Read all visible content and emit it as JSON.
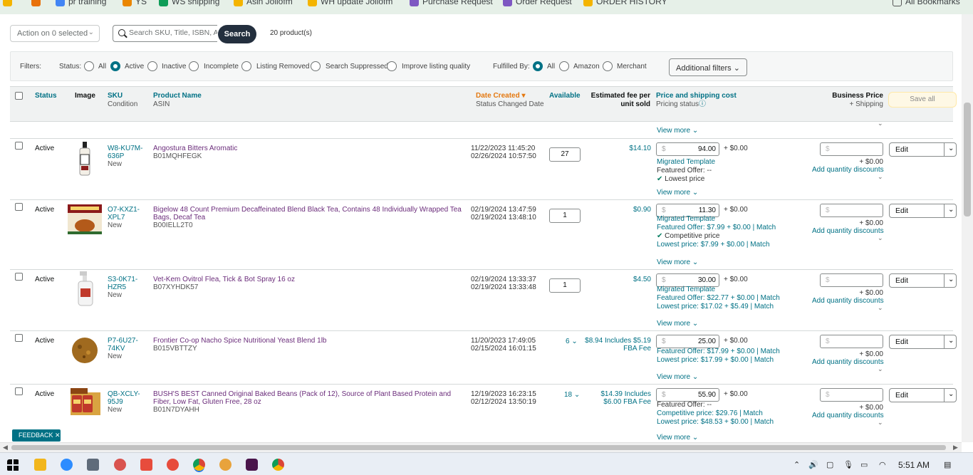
{
  "bookmarks": [
    "pr training",
    "YS",
    "WS shipping",
    "Asin Jollofm",
    "WH update Jollofm",
    "Purchase Request",
    "Order Request",
    "ORDER HISTORY",
    "All Bookmarks"
  ],
  "toolbar": {
    "action_label": "Action on 0 selected",
    "search_placeholder": "Search SKU, Title, ISBN, A",
    "search_button": "Search",
    "product_count": "20 product(s)"
  },
  "filters": {
    "label": "Filters:",
    "status_label": "Status:",
    "status_options": [
      "All",
      "Active",
      "Inactive",
      "Incomplete",
      "Listing Removed",
      "Search Suppressed",
      "Improve listing quality"
    ],
    "status_selected": "Active",
    "fulfilled_label": "Fulfilled By:",
    "fulfilled_options": [
      "All",
      "Amazon",
      "Merchant"
    ],
    "fulfilled_selected": "All",
    "additional_filters": "Additional filters"
  },
  "table_header": {
    "status": "Status",
    "image": "Image",
    "sku": "SKU",
    "condition": "Condition",
    "product_name": "Product Name",
    "asin": "ASIN",
    "date_created": "Date Created",
    "status_changed": "Status Changed Date",
    "available": "Available",
    "fee_line1": "Estimated fee per",
    "fee_line2": "unit sold",
    "price": "Price and shipping cost",
    "pricing_status": "Pricing status",
    "business_price": "Business Price",
    "plus_shipping": "+ Shipping",
    "save_all": "Save all"
  },
  "common": {
    "view_more": "View more",
    "edit": "Edit",
    "shipping": "+ $0.00",
    "bp_shipping": "+ $0.00",
    "add_qty_discounts": "Add quantity discounts",
    "dollar": "$"
  },
  "rows": [
    {
      "status": "Active",
      "sku1": "W8-KU7M-",
      "sku2": "636P",
      "condition": "New",
      "name": "Angostura Bitters Aromatic",
      "asin": "B01MQHFEGK",
      "date_created": "11/22/2023 11:45:20",
      "date_changed": "02/26/2024 10:57:50",
      "available": "27",
      "fee1": "$14.10",
      "fee2": "",
      "price": "94.00",
      "detail1": "Migrated Template",
      "detail2": "Featured Offer: --",
      "detail3": "Lowest price",
      "detail4": ""
    },
    {
      "status": "Active",
      "sku1": "O7-KXZ1-",
      "sku2": "XPL7",
      "condition": "New",
      "name": "Bigelow 48 Count Premium Decaffeinated Blend Black Tea, Contains 48 Individually Wrapped Tea Bags, Decaf Tea",
      "asin": "B00IELL2T0",
      "date_created": "02/19/2024 13:47:59",
      "date_changed": "02/19/2024 13:48:10",
      "available": "1",
      "fee1": "$0.90",
      "fee2": "",
      "price": "11.30",
      "detail1": "Migrated Template",
      "detail2": "Featured Offer: $7.99 + $0.00 | Match",
      "detail3": "Competitive price",
      "detail4": "Lowest price: $7.99 + $0.00 | Match"
    },
    {
      "status": "Active",
      "sku1": "S3-0K71-",
      "sku2": "HZR5",
      "condition": "New",
      "name": "Vet-Kem Ovitrol Flea, Tick & Bot Spray 16 oz",
      "asin": "B07XYHDK57",
      "date_created": "02/19/2024 13:33:37",
      "date_changed": "02/19/2024 13:33:48",
      "available": "1",
      "fee1": "$4.50",
      "fee2": "",
      "price": "30.00",
      "detail1": "Migrated Template",
      "detail2": "Featured Offer: $22.77 + $0.00 | Match",
      "detail3": "Lowest price: $17.02 + $5.49 | Match",
      "detail4": ""
    },
    {
      "status": "Active",
      "sku1": "P7-6U27-",
      "sku2": "74KV",
      "condition": "New",
      "name": "Frontier Co-op Nacho Spice Nutritional Yeast Blend 1lb",
      "asin": "B015VBTTZY",
      "date_created": "11/20/2023 17:49:05",
      "date_changed": "02/15/2024 16:01:15",
      "available": "6",
      "fee1": "$8.94 Includes $5.19",
      "fee2": "FBA Fee",
      "price": "25.00",
      "detail1": "Featured Offer: $17.99 + $0.00 | Match",
      "detail2": "Lowest price: $17.99 + $0.00 | Match",
      "detail3": "",
      "detail4": ""
    },
    {
      "status": "Active",
      "sku1": "QB-XCLY-",
      "sku2": "95J9",
      "condition": "New",
      "name": "BUSH'S BEST Canned Original Baked Beans (Pack of 12), Source of Plant Based Protein and Fiber, Low Fat, Gluten Free, 28 oz",
      "asin": "B01N7DYAHH",
      "date_created": "12/19/2023 16:23:15",
      "date_changed": "02/12/2024 13:50:19",
      "available": "18",
      "fee1": "$14.39 Includes",
      "fee2": "$6.00 FBA Fee",
      "price": "55.90",
      "detail1": "Featured Offer: --",
      "detail2": "Competitive price: $29.76 | Match",
      "detail3": "Lowest price: $48.53 + $0.00 | Match",
      "detail4": ""
    }
  ],
  "feedback": "FEEDBACK",
  "taskbar": {
    "time": "5:51 AM"
  }
}
